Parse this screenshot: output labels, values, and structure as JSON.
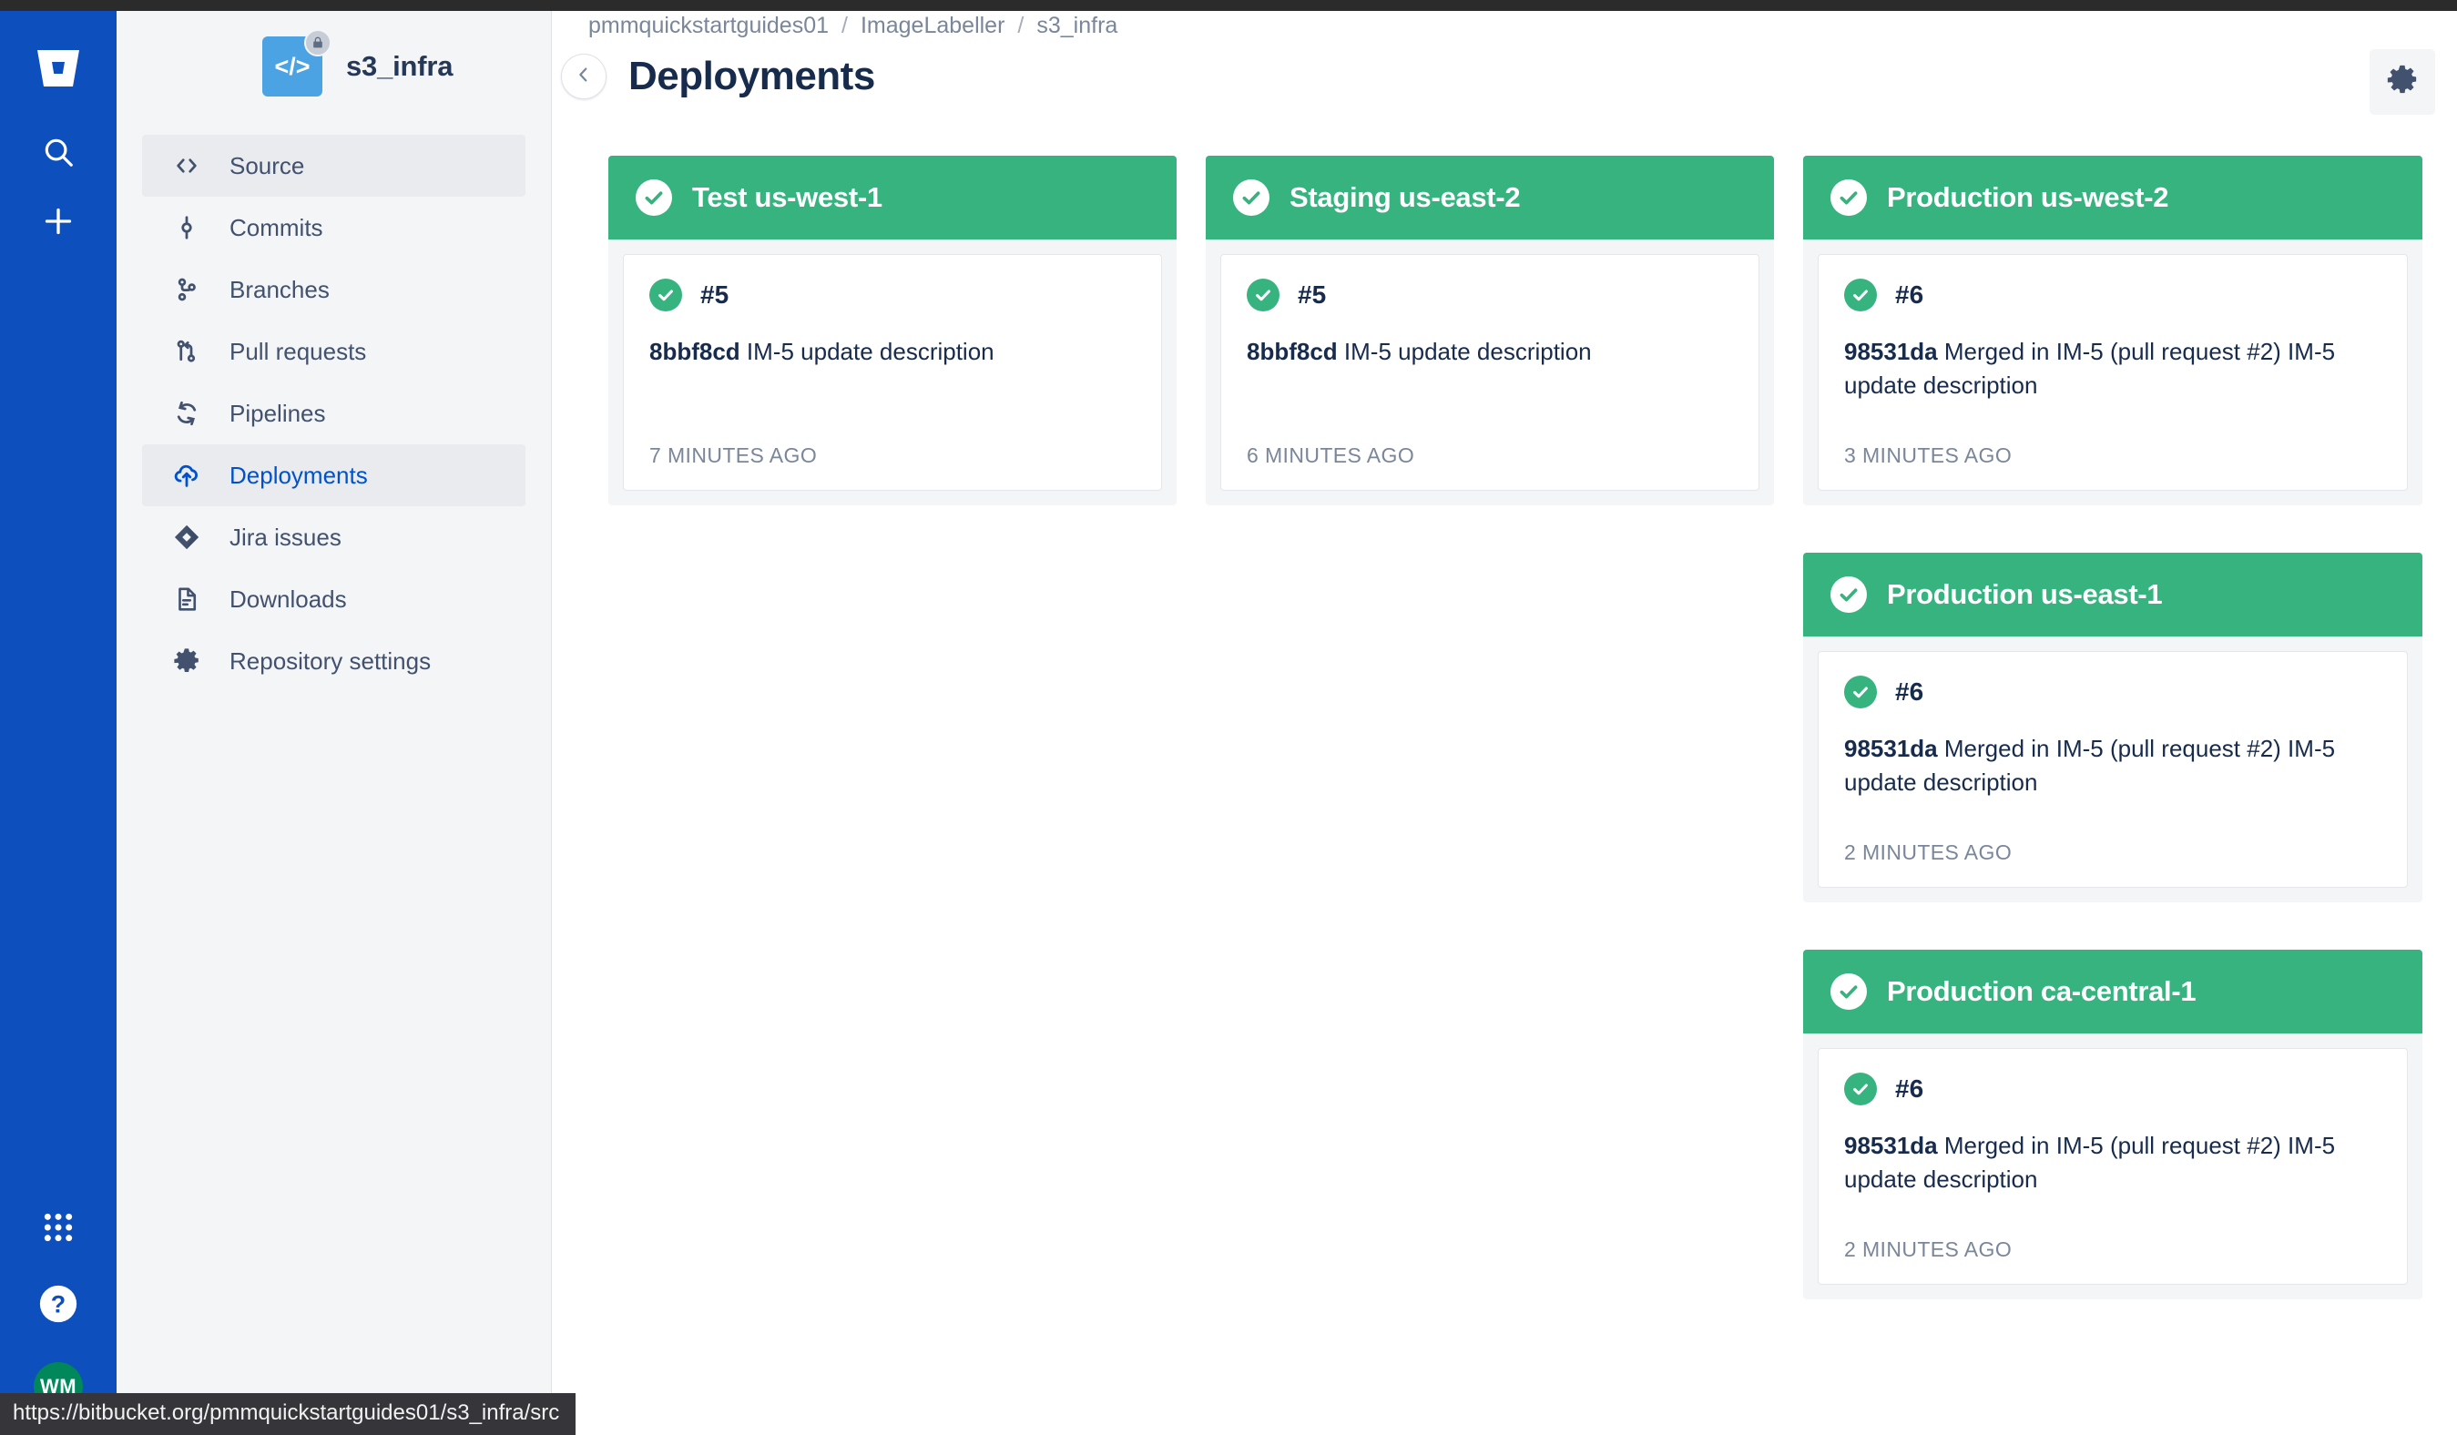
{
  "rail": {
    "logo_icon": "bitbucket-logo",
    "search_icon": "search-icon",
    "create_icon": "plus-icon",
    "apps_icon": "app-switcher-grid-icon",
    "help_icon": "help-question-icon",
    "avatar_initials": "WM"
  },
  "sidebar": {
    "repo_name": "s3_infra",
    "repo_avatar_glyph": "</>",
    "lock_icon": "lock-icon",
    "items": [
      {
        "label": "Source",
        "icon": "code-brackets-icon",
        "state": "hovered"
      },
      {
        "label": "Commits",
        "icon": "commit-icon",
        "state": "normal"
      },
      {
        "label": "Branches",
        "icon": "branch-icon",
        "state": "normal"
      },
      {
        "label": "Pull requests",
        "icon": "pull-request-icon",
        "state": "normal"
      },
      {
        "label": "Pipelines",
        "icon": "pipelines-icon",
        "state": "normal"
      },
      {
        "label": "Deployments",
        "icon": "deployments-cloud-icon",
        "state": "selected"
      },
      {
        "label": "Jira issues",
        "icon": "jira-diamond-icon",
        "state": "normal"
      },
      {
        "label": "Downloads",
        "icon": "document-icon",
        "state": "normal"
      },
      {
        "label": "Repository settings",
        "icon": "gear-icon",
        "state": "normal"
      }
    ]
  },
  "header": {
    "breadcrumb": [
      "pmmquickstartguides01",
      "ImageLabeller",
      "s3_infra"
    ],
    "separator": "/",
    "title": "Deployments",
    "collapse_icon": "chevron-left-icon",
    "settings_icon": "gear-icon"
  },
  "statusbar": {
    "url": "https://bitbucket.org/pmmquickstartguides01/s3_infra/src"
  },
  "colors": {
    "rail_blue": "#0c4fbd",
    "env_green": "#36b37e",
    "link_blue": "#0052cc",
    "text_dark": "#172b4d",
    "text_muted": "#7a869a",
    "sidebar_bg": "#f4f5f7"
  },
  "columns": [
    {
      "cards": [
        {
          "env_name": "Test us-west-1",
          "status_icon": "check-circle-icon",
          "deployment_number": "#5",
          "commit_hash": "8bbf8cd",
          "commit_message": "IM-5 update description",
          "timestamp": "7 MINUTES AGO"
        }
      ]
    },
    {
      "cards": [
        {
          "env_name": "Staging us-east-2",
          "status_icon": "check-circle-icon",
          "deployment_number": "#5",
          "commit_hash": "8bbf8cd",
          "commit_message": "IM-5 update description",
          "timestamp": "6 MINUTES AGO"
        }
      ]
    },
    {
      "cards": [
        {
          "env_name": "Production us-west-2",
          "status_icon": "check-circle-icon",
          "deployment_number": "#6",
          "commit_hash": "98531da",
          "commit_message": "Merged in IM-5 (pull request #2) IM-5 update description",
          "timestamp": "3 MINUTES AGO"
        },
        {
          "env_name": "Production us-east-1",
          "status_icon": "check-circle-icon",
          "deployment_number": "#6",
          "commit_hash": "98531da",
          "commit_message": "Merged in IM-5 (pull request #2) IM-5 update description",
          "timestamp": "2 MINUTES AGO"
        },
        {
          "env_name": "Production ca-central-1",
          "status_icon": "check-circle-icon",
          "deployment_number": "#6",
          "commit_hash": "98531da",
          "commit_message": "Merged in IM-5 (pull request #2) IM-5 update description",
          "timestamp": "2 MINUTES AGO"
        }
      ]
    }
  ]
}
